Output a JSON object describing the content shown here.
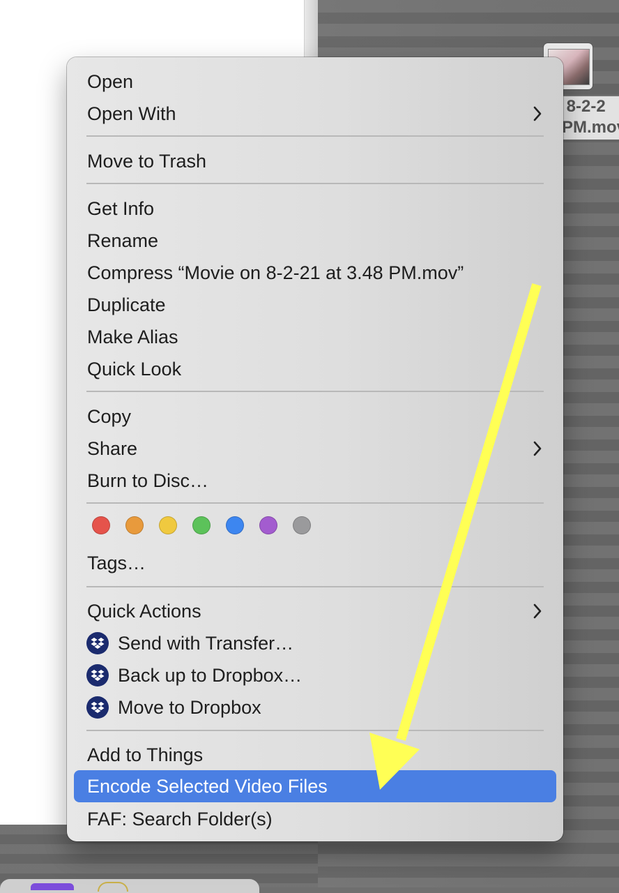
{
  "desktop_file": {
    "label_line1": " 8-2-2",
    "label_line2": "PM.mov"
  },
  "menu": {
    "open": "Open",
    "open_with": "Open With",
    "move_to_trash": "Move to Trash",
    "get_info": "Get Info",
    "rename": "Rename",
    "compress": "Compress “Movie on 8-2-21 at 3.48 PM.mov”",
    "duplicate": "Duplicate",
    "make_alias": "Make Alias",
    "quick_look": "Quick Look",
    "copy": "Copy",
    "share": "Share",
    "burn_to_disc": "Burn to Disc…",
    "tags": "Tags…",
    "quick_actions": "Quick Actions",
    "send_with_transfer": "Send with Transfer…",
    "back_up_to_dropbox": "Back up to Dropbox…",
    "move_to_dropbox": "Move to Dropbox",
    "add_to_things": "Add to Things",
    "encode_selected_video_files": "Encode Selected Video Files",
    "faf_search_folders": "FAF: Search Folder(s)"
  },
  "tag_colors": [
    "#e5534b",
    "#e89a3c",
    "#f0c93f",
    "#5cc25a",
    "#3d86f0",
    "#a35ccf",
    "#9a9a9c"
  ],
  "colors": {
    "highlight": "#4a7fe3",
    "annotation_arrow": "#ffff55",
    "dropbox_badge": "#1b2b6e"
  },
  "icons": {
    "submenu": "chevron-right-icon",
    "dropbox": "dropbox-icon",
    "annotation": "arrow-annotation"
  }
}
